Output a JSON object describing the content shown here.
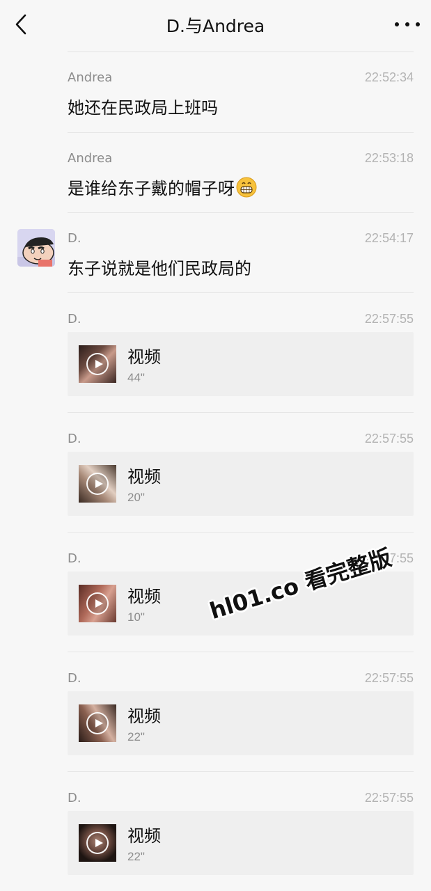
{
  "nav": {
    "title": "D.与Andrea"
  },
  "messages": [
    {
      "type": "text",
      "sender": "Andrea",
      "time": "22:52:34",
      "text": "她还在民政局上班吗"
    },
    {
      "type": "text",
      "sender": "Andrea",
      "time": "22:53:18",
      "text": "是谁给东子戴的帽子呀",
      "emoji": "grinning-face-emoji"
    },
    {
      "type": "text",
      "sender": "D.",
      "time": "22:54:17",
      "text": "东子说就是他们民政局的",
      "avatar": "cartoon-boy-avatar"
    },
    {
      "type": "video",
      "sender": "D.",
      "time": "22:57:55",
      "label": "视频",
      "duration": "44\""
    },
    {
      "type": "video",
      "sender": "D.",
      "time": "22:57:55",
      "label": "视频",
      "duration": "20\""
    },
    {
      "type": "video",
      "sender": "D.",
      "time": "22:57:55",
      "label": "视频",
      "duration": "10\""
    },
    {
      "type": "video",
      "sender": "D.",
      "time": "22:57:55",
      "label": "视频",
      "duration": "22\""
    },
    {
      "type": "video",
      "sender": "D.",
      "time": "22:57:55",
      "label": "视频",
      "duration": "22\""
    }
  ],
  "watermark": "hl01.co 看完整版",
  "icons": {
    "back": "chevron-left-icon",
    "more": "more-dots-icon",
    "play": "play-icon"
  },
  "colors": {
    "background": "#f7f7f7",
    "card": "#efefef",
    "secondary_text": "#8c8c8c"
  }
}
